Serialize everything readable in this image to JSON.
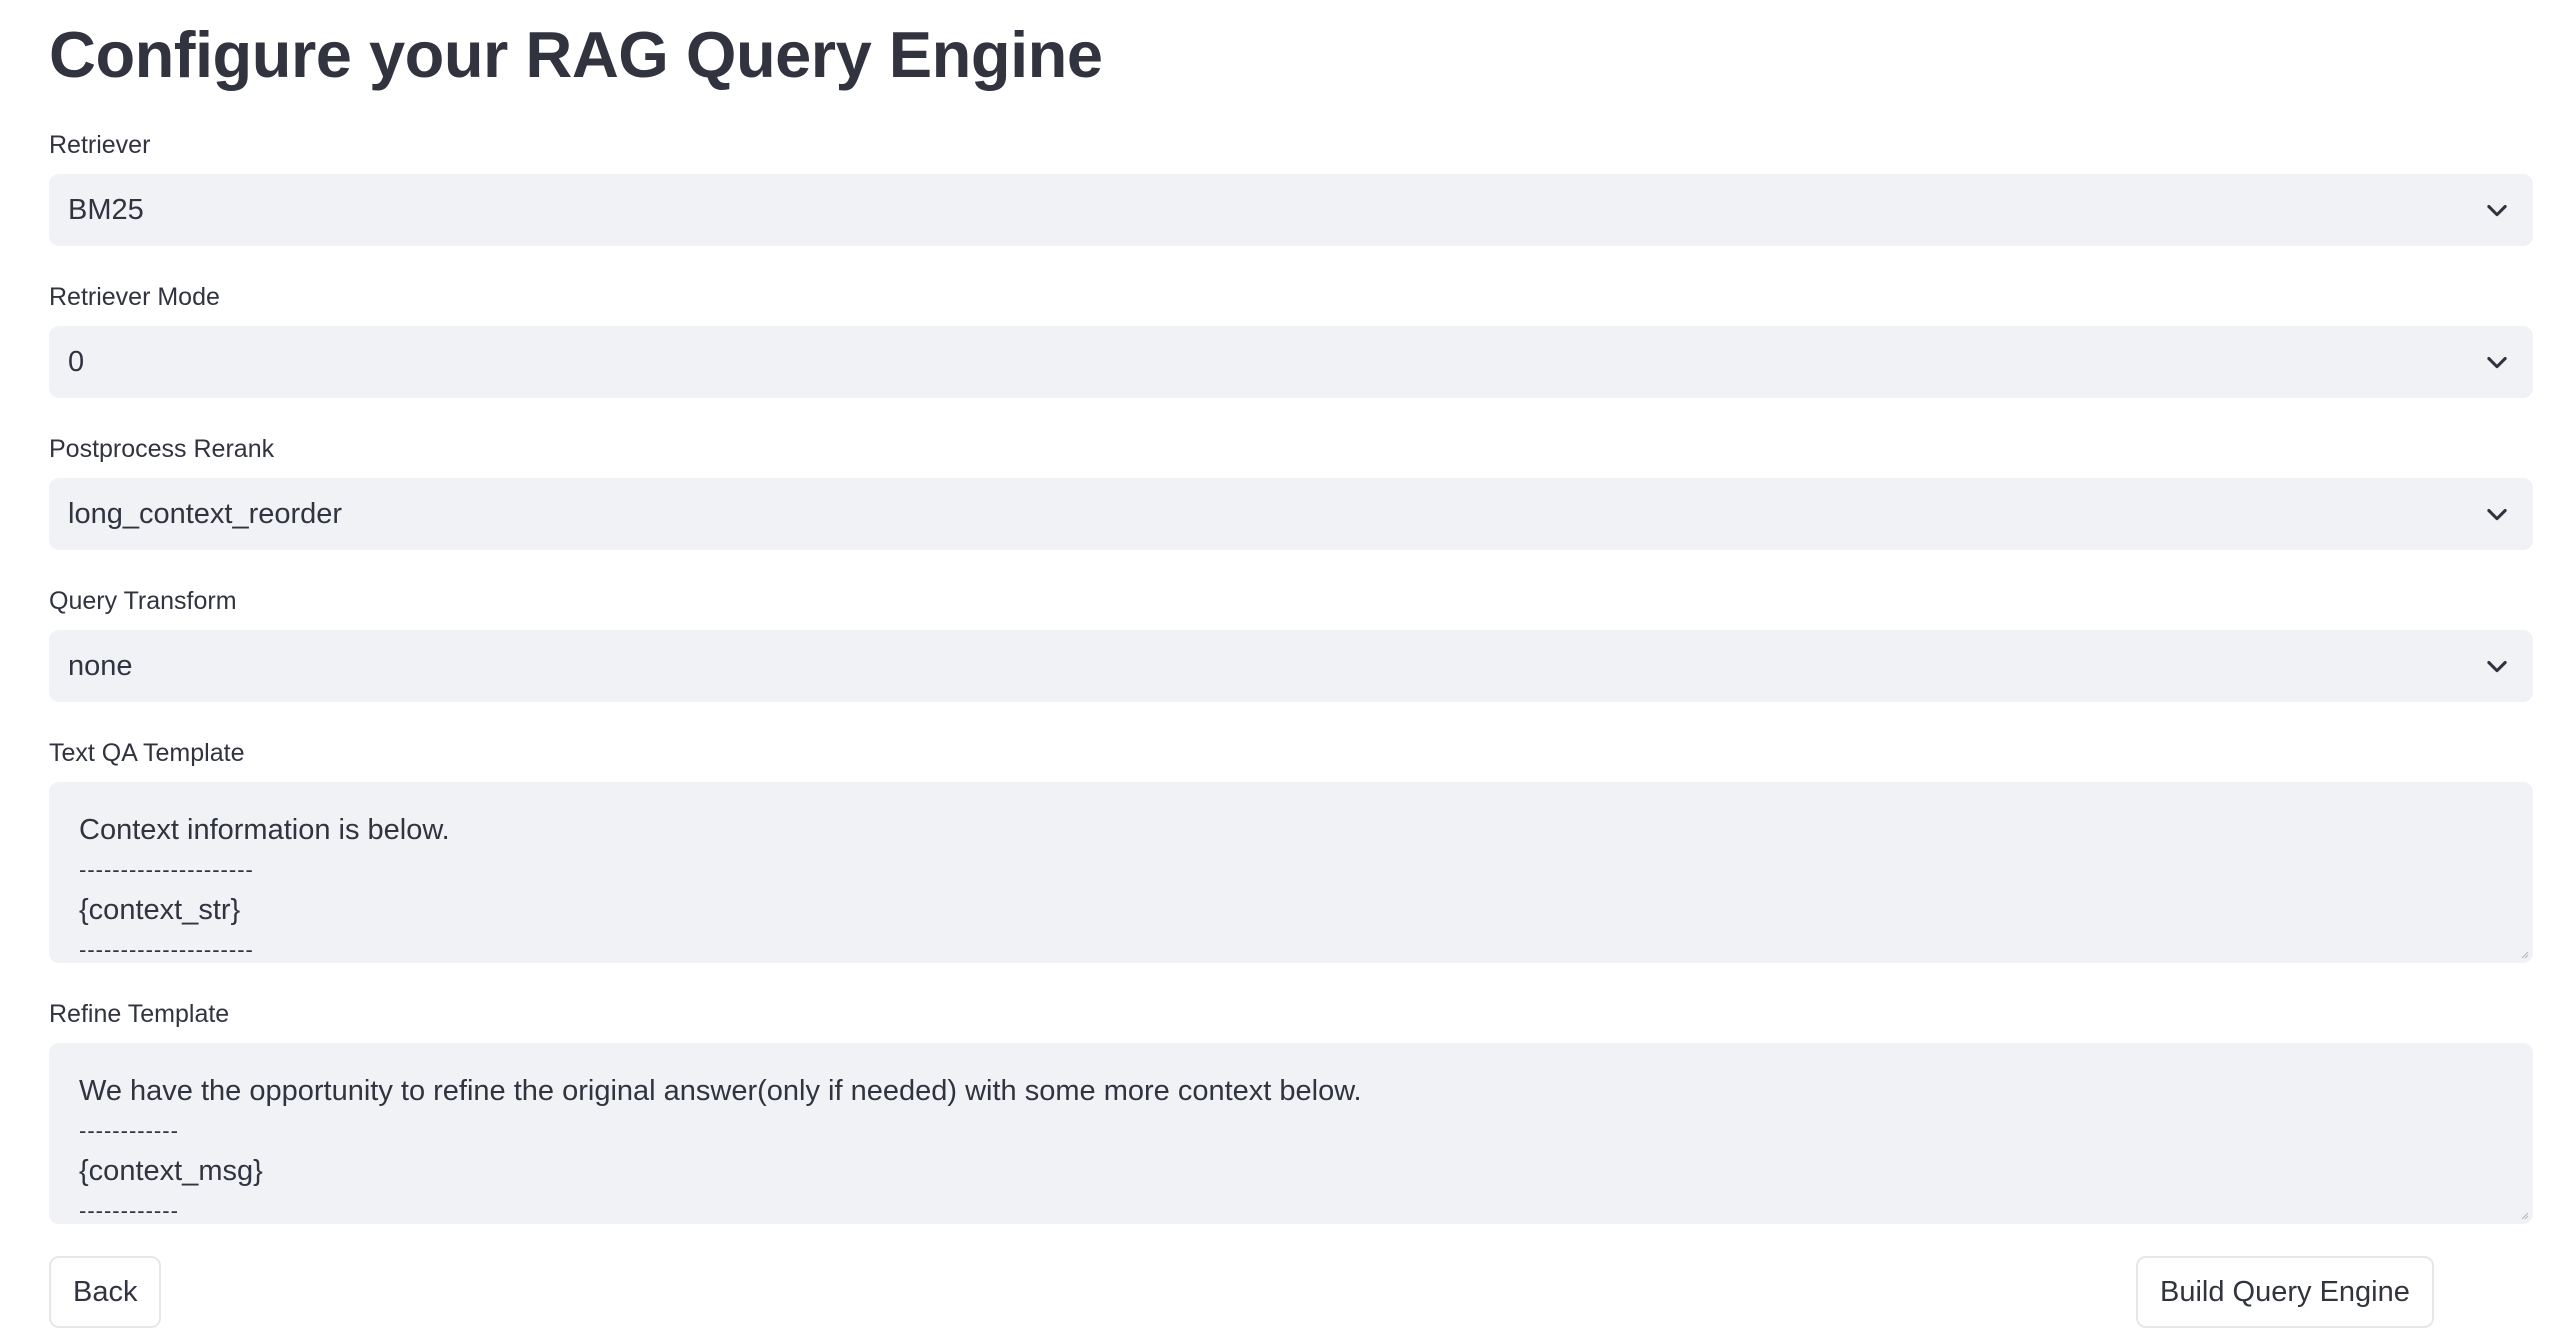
{
  "page": {
    "title": "Configure your RAG Query Engine"
  },
  "fields": {
    "retriever": {
      "label": "Retriever",
      "value": "BM25"
    },
    "retriever_mode": {
      "label": "Retriever Mode",
      "value": "0"
    },
    "postprocess_rerank": {
      "label": "Postprocess Rerank",
      "value": "long_context_reorder"
    },
    "query_transform": {
      "label": "Query Transform",
      "value": "none"
    },
    "text_qa_template": {
      "label": "Text QA Template",
      "lines": [
        "Context information is below.",
        "---------------------",
        "{context_str}",
        "---------------------"
      ]
    },
    "refine_template": {
      "label": "Refine Template",
      "lines": [
        "We have the opportunity to refine the original answer(only if needed) with some more context below.",
        "------------",
        "{context_msg}",
        "------------"
      ]
    }
  },
  "buttons": {
    "back": "Back",
    "build": "Build Query Engine"
  },
  "icons": {
    "select_arrow": "chevron-down-icon",
    "textarea_resize": "resize-grip-icon"
  },
  "colors": {
    "input_bg": "#f0f2f6",
    "text": "#31333f",
    "button_border": "#e6e7eb"
  }
}
